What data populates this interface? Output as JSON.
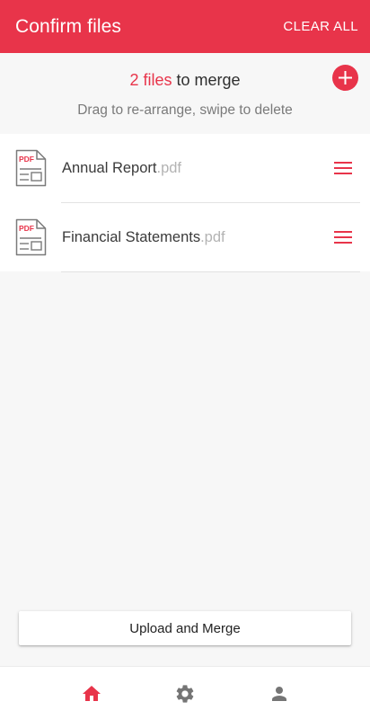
{
  "header": {
    "title": "Confirm files",
    "clear_all": "CLEAR ALL"
  },
  "summary": {
    "count_label": "2 files",
    "count_suffix": " to merge",
    "hint": "Drag to re-arrange, swipe to delete"
  },
  "files": [
    {
      "name": "Annual Report",
      "ext": ".pdf",
      "icon_text": "PDF"
    },
    {
      "name": "Financial Statements",
      "ext": ".pdf",
      "icon_text": "PDF"
    }
  ],
  "upload_button": {
    "label": "Upload and Merge"
  },
  "bottom_nav": [
    {
      "icon": "home-icon",
      "active": true
    },
    {
      "icon": "gear-icon",
      "active": false
    },
    {
      "icon": "person-icon",
      "active": false
    }
  ],
  "colors": {
    "accent": "#e8344a",
    "inactive_icon": "#757575"
  }
}
